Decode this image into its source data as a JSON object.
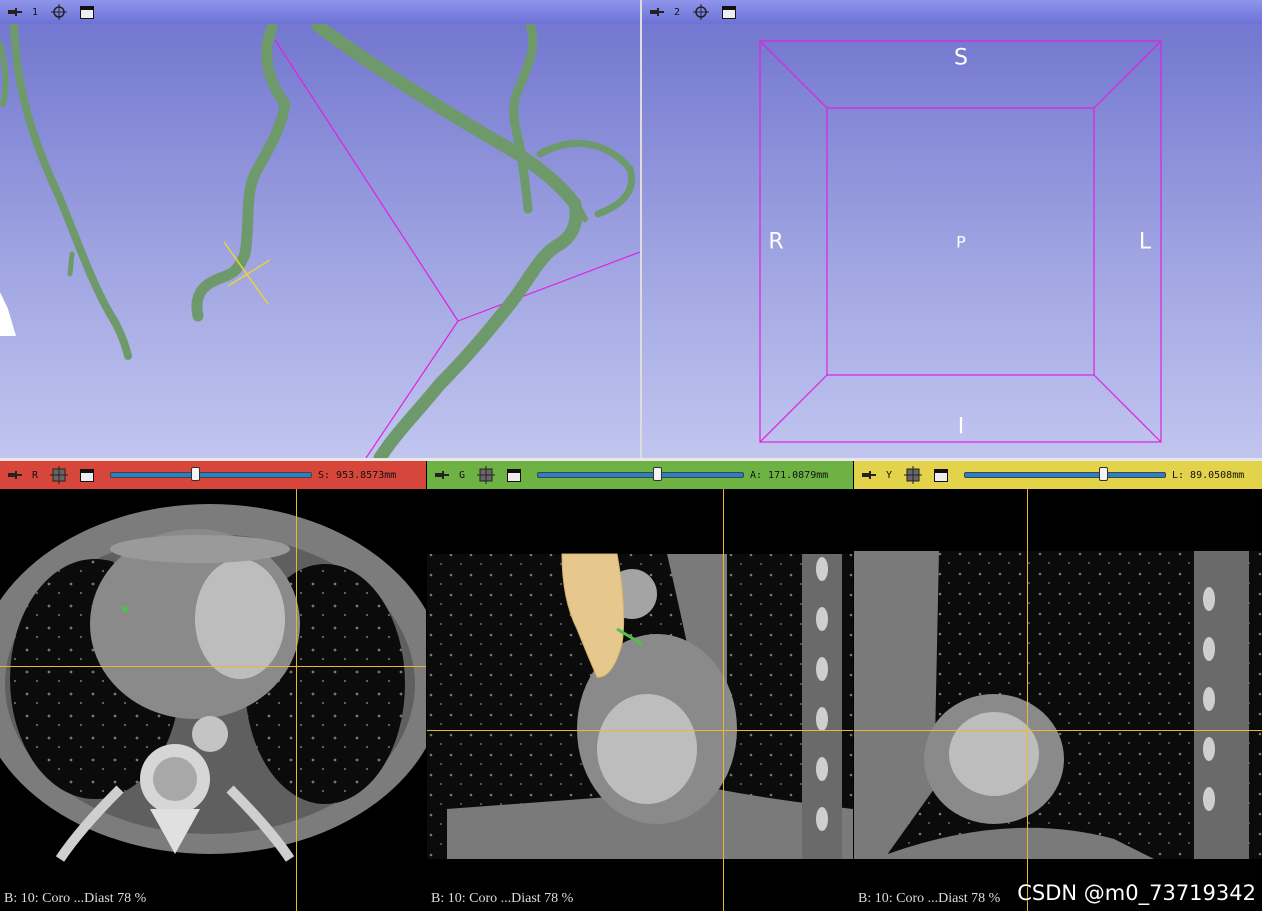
{
  "views": {
    "threeD_1": {
      "index": "1"
    },
    "threeD_2": {
      "index": "2",
      "orientation": {
        "superior": "S",
        "inferior": "I",
        "right": "R",
        "left": "L",
        "posterior": "P"
      }
    },
    "red": {
      "label": "R",
      "offset": "S: 953.8573mm",
      "slider_position": 0.42,
      "corner": "B: 10: Coro  ...Diast 78 %"
    },
    "green": {
      "label": "G",
      "offset": "A: 171.0879mm",
      "slider_position": 0.58,
      "corner": "B: 10: Coro  ...Diast 78 %"
    },
    "yellow": {
      "label": "Y",
      "offset": "L: 89.0508mm",
      "slider_position": 0.69,
      "corner": "B: 10: Coro  ...Diast 78 %"
    }
  },
  "watermark": "CSDN @m0_73719342",
  "colors": {
    "red_bar": "#d6463b",
    "green_bar": "#6fb244",
    "yellow_bar": "#e3d34a",
    "blue_bar": "#7a80dd",
    "vessel": "#6e9a6b",
    "bbox": "#e020e0",
    "crosshair": "#e8b930",
    "aorta_seg": "#e6c88f"
  }
}
